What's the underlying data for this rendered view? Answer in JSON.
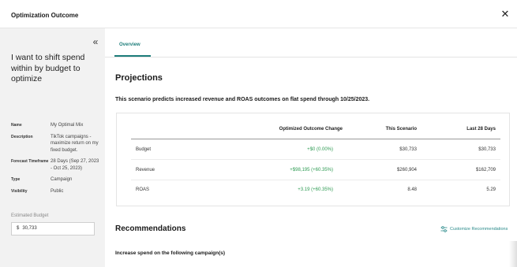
{
  "window": {
    "title": "Optimization Outcome"
  },
  "sidebar": {
    "goal": "I want to shift spend within by budget to optimize",
    "fields": [
      {
        "key": "Name",
        "value": "My Optimal Mix"
      },
      {
        "key": "Description",
        "value": "TikTok campaigns - maximize return on my fixed budget."
      },
      {
        "key": "Forecast Timeframe",
        "value": "28 Days (Sep 27, 2023 - Oct 25, 2023)"
      },
      {
        "key": "Type",
        "value": "Campaign"
      },
      {
        "key": "Visibility",
        "value": "Public"
      }
    ],
    "budget_label": "Estimated Budget",
    "budget_currency": "$",
    "budget_value": "30,733"
  },
  "tabs": [
    {
      "label": "Overview",
      "active": true
    }
  ],
  "projections": {
    "heading": "Projections",
    "description": "This scenario predicts increased revenue and ROAS outcomes on flat spend through 10/25/2023.",
    "columns": [
      "",
      "Optimized Outcome Change",
      "This Scenario",
      "Last 28 Days"
    ],
    "rows": [
      {
        "metric": "Budget",
        "change": "+$0 (0.00%)",
        "scenario": "$30,733",
        "last28": "$30,733"
      },
      {
        "metric": "Revenue",
        "change": "+$98,195 (+60.35%)",
        "scenario": "$260,904",
        "last28": "$162,709"
      },
      {
        "metric": "ROAS",
        "change": "+3.19 (+60.35%)",
        "scenario": "8.48",
        "last28": "5.29"
      }
    ]
  },
  "recommendations": {
    "heading": "Recommendations",
    "customize_label": "Customize Recommendations",
    "subheading": "Increase spend on the following campaign(s)"
  },
  "colors": {
    "accent": "#1d7d7a",
    "positive": "#2e9b53",
    "sidebar_bg": "#f2f2f2"
  },
  "icons": {
    "close": "close-icon",
    "collapse": "double-chevron-left-icon",
    "customize": "sliders-icon"
  }
}
